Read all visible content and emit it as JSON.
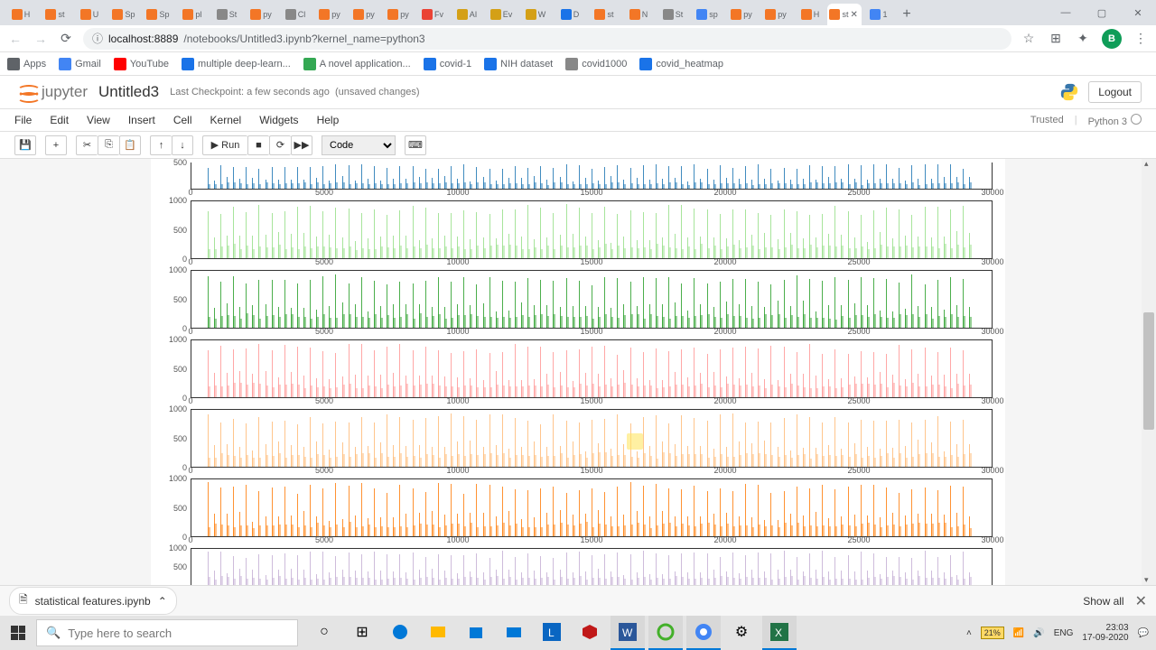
{
  "browser": {
    "tabs": [
      {
        "label": "H",
        "color": "#f37626"
      },
      {
        "label": "st",
        "color": "#f37626"
      },
      {
        "label": "U",
        "color": "#f37626"
      },
      {
        "label": "Sp",
        "color": "#f37626"
      },
      {
        "label": "Sp",
        "color": "#f37626"
      },
      {
        "label": "pl",
        "color": "#f37626"
      },
      {
        "label": "St",
        "color": "#888"
      },
      {
        "label": "py",
        "color": "#f37626"
      },
      {
        "label": "Cl",
        "color": "#888"
      },
      {
        "label": "py",
        "color": "#f37626"
      },
      {
        "label": "py",
        "color": "#f37626"
      },
      {
        "label": "py",
        "color": "#f37626"
      },
      {
        "label": "Fv",
        "color": "#ea4335"
      },
      {
        "label": "AI",
        "color": "#d4a017"
      },
      {
        "label": "Ev",
        "color": "#d4a017"
      },
      {
        "label": "W",
        "color": "#d4a017"
      },
      {
        "label": "D",
        "color": "#1a73e8"
      },
      {
        "label": "st",
        "color": "#f37626"
      },
      {
        "label": "N",
        "color": "#f37626"
      },
      {
        "label": "St",
        "color": "#888"
      },
      {
        "label": "sp",
        "color": "#4285f4"
      },
      {
        "label": "py",
        "color": "#f37626"
      },
      {
        "label": "py",
        "color": "#f37626"
      },
      {
        "label": "H",
        "color": "#f37626"
      },
      {
        "label": "st",
        "color": "#f37626",
        "active": true
      },
      {
        "label": "1",
        "color": "#4285f4"
      }
    ],
    "url_host": "localhost:8889",
    "url_path": "/notebooks/Untitled3.ipynb?kernel_name=python3",
    "bookmarks": [
      {
        "label": "Apps",
        "color": "#5f6368"
      },
      {
        "label": "Gmail",
        "color": "#4285f4"
      },
      {
        "label": "YouTube",
        "color": "#ff0000"
      },
      {
        "label": "multiple deep-learn...",
        "color": "#1a73e8"
      },
      {
        "label": "A novel application...",
        "color": "#34a853"
      },
      {
        "label": "covid-1",
        "color": "#1a73e8"
      },
      {
        "label": "NIH dataset",
        "color": "#1a73e8"
      },
      {
        "label": "covid1000",
        "color": "#888"
      },
      {
        "label": "covid_heatmap",
        "color": "#1a73e8"
      }
    ],
    "avatar_initial": "B"
  },
  "jupyter": {
    "logo_text": "jupyter",
    "notebook_title": "Untitled3",
    "checkpoint": "Last Checkpoint: a few seconds ago",
    "unsaved": "(unsaved changes)",
    "logout": "Logout",
    "menus": [
      "File",
      "Edit",
      "View",
      "Insert",
      "Cell",
      "Kernel",
      "Widgets",
      "Help"
    ],
    "trusted": "Trusted",
    "kernel": "Python 3",
    "run_label": "Run",
    "cell_type": "Code"
  },
  "chart_data": [
    {
      "type": "line",
      "color": "#1f77b4",
      "xlim": [
        0,
        30000
      ],
      "ylim": [
        0,
        1000
      ],
      "xticks": [
        0,
        5000,
        10000,
        15000,
        20000,
        25000,
        30000
      ],
      "yticks": [
        500
      ],
      "partial_top": true
    },
    {
      "type": "line",
      "color": "#98df8a",
      "xlim": [
        0,
        30000
      ],
      "ylim": [
        0,
        1000
      ],
      "xticks": [
        0,
        5000,
        10000,
        15000,
        20000,
        25000,
        30000
      ],
      "yticks": [
        0,
        500,
        1000
      ]
    },
    {
      "type": "line",
      "color": "#2ca02c",
      "xlim": [
        0,
        30000
      ],
      "ylim": [
        0,
        1000
      ],
      "xticks": [
        0,
        5000,
        10000,
        15000,
        20000,
        25000,
        30000
      ],
      "yticks": [
        0,
        500,
        1000
      ]
    },
    {
      "type": "line",
      "color": "#ff9896",
      "xlim": [
        0,
        30000
      ],
      "ylim": [
        0,
        1000
      ],
      "xticks": [
        0,
        5000,
        10000,
        15000,
        20000,
        25000,
        30000
      ],
      "yticks": [
        0,
        500,
        1000
      ]
    },
    {
      "type": "line",
      "color": "#ffbb78",
      "xlim": [
        0,
        30000
      ],
      "ylim": [
        0,
        1000
      ],
      "xticks": [
        0,
        5000,
        10000,
        15000,
        20000,
        25000,
        30000
      ],
      "yticks": [
        0,
        500,
        1000
      ]
    },
    {
      "type": "line",
      "color": "#ff7f0e",
      "xlim": [
        0,
        30000
      ],
      "ylim": [
        0,
        1000
      ],
      "xticks": [
        0,
        5000,
        10000,
        15000,
        20000,
        25000,
        30000
      ],
      "yticks": [
        0,
        500,
        1000
      ]
    },
    {
      "type": "line",
      "color": "#c5b0d5",
      "xlim": [
        0,
        30000
      ],
      "ylim": [
        0,
        1000
      ],
      "xticks": [
        0,
        5000,
        10000,
        15000,
        20000,
        25000,
        30000
      ],
      "yticks": [
        500,
        1000
      ],
      "partial_bottom": true
    }
  ],
  "downloads": {
    "item": "statistical features.ipynb",
    "showall": "Show all"
  },
  "taskbar": {
    "search_placeholder": "Type here to search",
    "battery": "21%",
    "lang": "ENG",
    "time": "23:03",
    "date": "17-09-2020"
  }
}
